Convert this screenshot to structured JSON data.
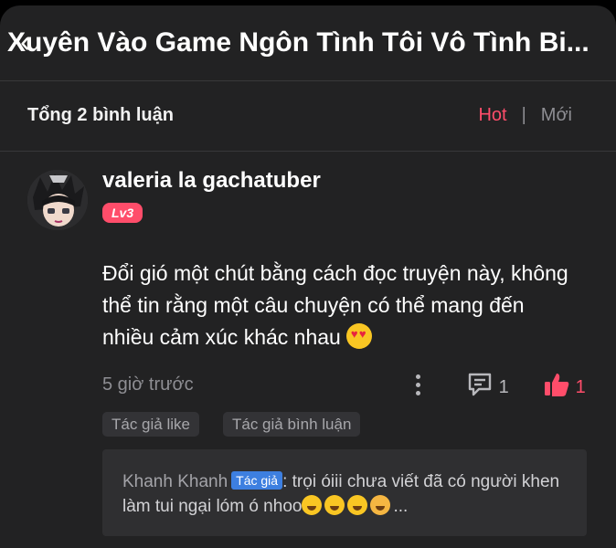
{
  "header": {
    "title": "Xuyên Vào Game Ngôn Tình Tôi Vô Tình Bi...",
    "back_icon": "back-chevron-icon"
  },
  "comments_bar": {
    "count_label": "Tổng 2 bình luận",
    "sort_hot": "Hot",
    "sort_separator": "|",
    "sort_new": "Mới",
    "accent_color": "#ff4d6a"
  },
  "comment": {
    "username": "valeria la gachatuber",
    "level": "Lv3",
    "text": "Đổi gió một chút bằng cách đọc truyện này, không thể tin rằng một câu chuyện có thể mang đến nhiều cảm xúc khác nhau",
    "emoji": "heart-eyes-emoji",
    "time": "5 giờ trước",
    "reply_count": "1",
    "like_count": "1",
    "tags": [
      "Tác giả like",
      "Tác giả bình luận"
    ]
  },
  "reply": {
    "name": "Khanh Khanh",
    "badge": "Tác giả",
    "text": ": trọi óiii chưa viết đã có người khen làm tui ngại lóm ó nhoo",
    "ellipsis": "..."
  }
}
